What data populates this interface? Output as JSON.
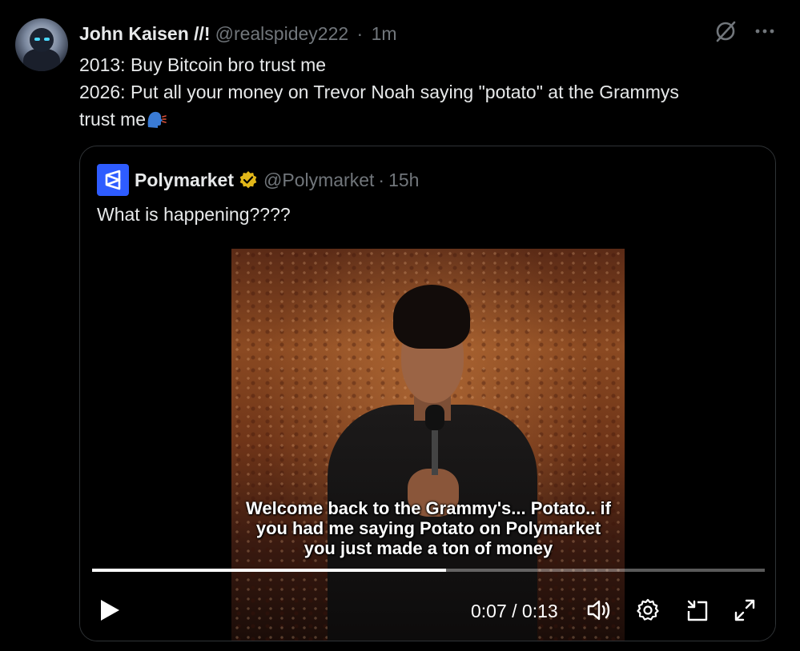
{
  "tweet": {
    "author_name": "John Kaisen //!",
    "author_handle": "@realspidey222",
    "separator": "·",
    "time": "1m",
    "lines": [
      "2013: Buy Bitcoin bro trust me",
      "2026: Put all your money on Trevor Noah saying \"potato\" at the Grammys",
      "trust me"
    ],
    "emoji": "speaking-head-emoji"
  },
  "quoted": {
    "author_name": "Polymarket",
    "author_handle": "@Polymarket",
    "separator": "·",
    "time": "15h",
    "text": "What is happening????",
    "verified_color": "#e2b719",
    "logo_color": "#2e5cff"
  },
  "video": {
    "caption_lines": [
      "Welcome back to the Grammy's... Potato.. if",
      "you had me saying Potato on Polymarket",
      "you just made a ton of money"
    ],
    "time_display": "0:07 / 0:13",
    "progress_fraction": 0.526,
    "icons": [
      "play-icon",
      "volume-icon",
      "settings-icon",
      "pip-icon",
      "fullscreen-icon"
    ]
  },
  "top_icons": [
    "grok-icon",
    "more-icon"
  ]
}
